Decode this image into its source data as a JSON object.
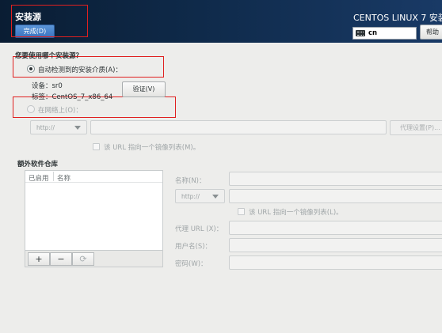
{
  "header": {
    "title": "安装源",
    "done_label": "完成(D)",
    "product": "CENTOS LINUX 7 安装",
    "keyboard": "cn",
    "help_label": "帮助"
  },
  "source": {
    "question": "您要使用哪个安装源？",
    "auto_option": "自动检测到的安装介质(A)：",
    "device": "设备：sr0",
    "label": "标签：CentOS_7_x86_64",
    "verify_label": "验证(V)",
    "network_option": "在网络上(O)：",
    "protocol": "http://",
    "url": "",
    "proxy_label": "代理设置(P)...",
    "mirror_checkbox": "该 URL 指向一个镜像列表(M)。"
  },
  "repos": {
    "section_title": "额外软件仓库",
    "col_enabled": "已启用",
    "col_name": "名称",
    "add": "+",
    "remove": "−",
    "refresh": "⟳",
    "name_label": "名称(N)：",
    "name_value": "",
    "protocol": "http://",
    "url_value": "",
    "mirror_checkbox": "该 URL 指向一个镜像列表(L)。",
    "proxy_url_label": "代理 URL (X)：",
    "username_label": "用户名(S)：",
    "password_label": "密码(W)："
  },
  "colors": {
    "header_bg": "#0f2a4a",
    "done_button": "#4a84cc",
    "highlight_box": "#e02020"
  }
}
